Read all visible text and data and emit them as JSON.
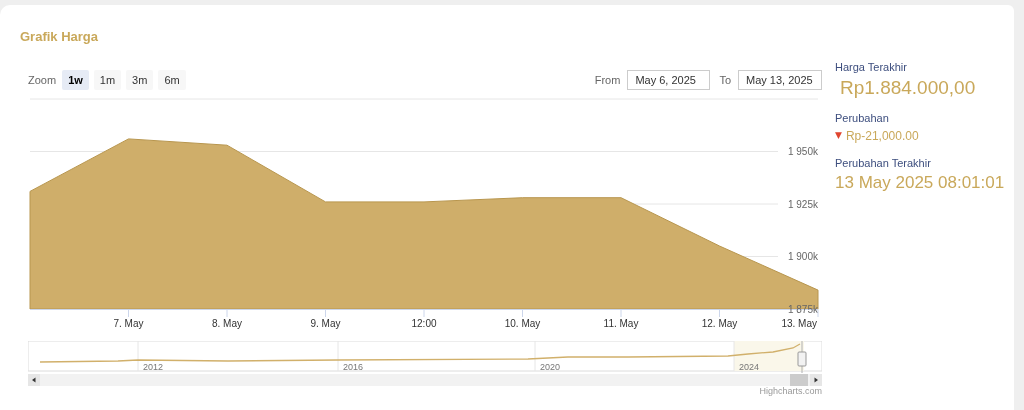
{
  "title": "Grafik Harga",
  "zoom": {
    "label": "Zoom",
    "buttons": [
      {
        "label": "1w",
        "selected": true
      },
      {
        "label": "1m",
        "selected": false
      },
      {
        "label": "3m",
        "selected": false
      },
      {
        "label": "6m",
        "selected": false
      }
    ]
  },
  "range": {
    "from_label": "From",
    "from": "May 6, 2025",
    "to_label": "To",
    "to": "May 13, 2025"
  },
  "chart_data": {
    "type": "area",
    "grid": true,
    "categories": [
      null,
      "7. May",
      "8. May",
      "9. May",
      "12:00",
      "10. May",
      "11. May",
      "12. May",
      "13. May"
    ],
    "series": [
      {
        "color": "#cfae6a",
        "values": [
          1931000,
          1956000,
          1953000,
          1926000,
          1926000,
          1928000,
          1928000,
          1905000,
          1884000
        ]
      }
    ],
    "ylim": [
      1875000,
      1975000
    ],
    "yticks": [
      {
        "value": 1875000,
        "label": "1 875k"
      },
      {
        "value": 1900000,
        "label": "1 900k"
      },
      {
        "value": 1925000,
        "label": "1 925k"
      },
      {
        "value": 1950000,
        "label": "1 950k"
      }
    ]
  },
  "navigator": {
    "years": [
      "2012",
      "2016",
      "2020",
      "2024"
    ]
  },
  "credit": "Highcharts.com",
  "summary": [
    {
      "label": "Harga Terakhir",
      "value": "Rp1.884.000,00"
    },
    {
      "label": "Perubahan",
      "value": "Rp-21,000.00",
      "arrow": "▼"
    },
    {
      "label": "Perubahan Terakhir",
      "value": "13 May 2025 08:01:01"
    }
  ]
}
